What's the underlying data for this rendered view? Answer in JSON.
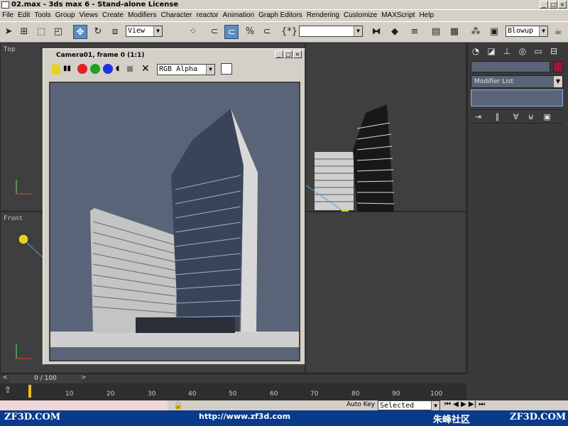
{
  "window": {
    "title": "02.max - 3ds max 6 - Stand-alone License"
  },
  "menu": [
    "File",
    "Edit",
    "Tools",
    "Group",
    "Views",
    "Create",
    "Modifiers",
    "Character",
    "reactor",
    "Animation",
    "Graph Editors",
    "Rendering",
    "Customize",
    "MAXScript",
    "Help"
  ],
  "toolbar": {
    "view_combo": "View",
    "blowup_combo": "Blowup"
  },
  "viewports": {
    "top_label": "Top",
    "front_label": "Front"
  },
  "render_window": {
    "title": "Camera01, frame 0 (1:1)",
    "channel_combo": "RGB Alpha"
  },
  "command_panel": {
    "modifier_list": "Modifier List",
    "accent_color": "#a0143c"
  },
  "timeslider": {
    "label": "0 / 100"
  },
  "track": {
    "ticks": [
      "10",
      "20",
      "30",
      "40",
      "50",
      "60",
      "70",
      "80",
      "90",
      "100"
    ]
  },
  "status": {
    "autokey": "Auto Key",
    "selected": "Selected"
  },
  "banner": {
    "left": "ZF3D.COM",
    "url": "http://www.zf3d.com",
    "cn": "朱峰社区",
    "right": "ZF3D.COM"
  }
}
